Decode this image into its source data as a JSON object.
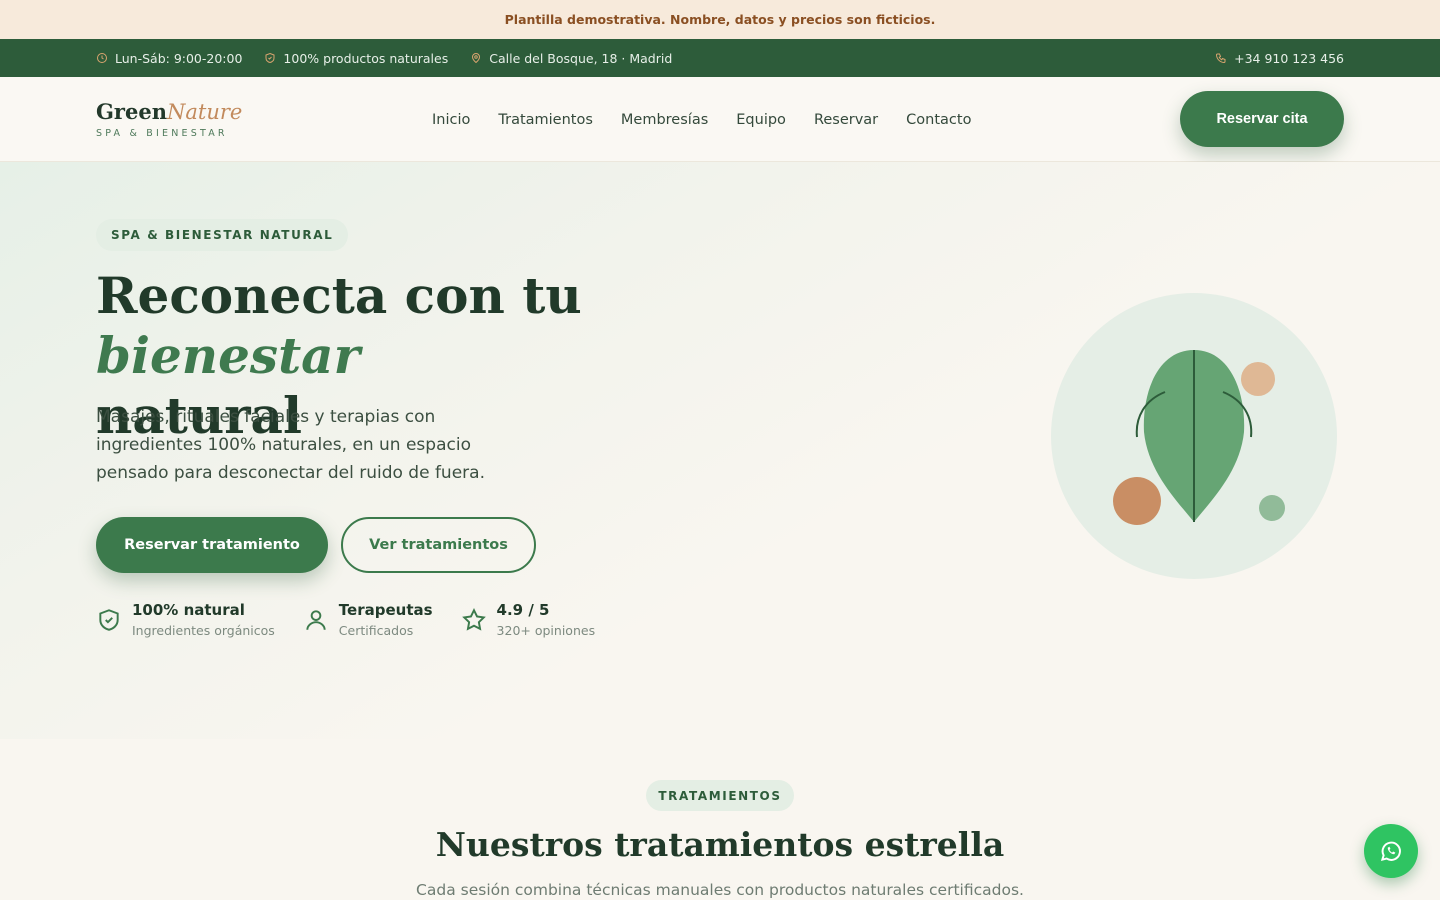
{
  "notice": "Plantilla demostrativa. Nombre, datos y precios son ficticios.",
  "topbar": {
    "hours": "Lun-Sáb: 9:00-20:00",
    "natural": "100% productos naturales",
    "address": "Calle del Bosque, 18 · Madrid",
    "phone": "+34 910 123 456"
  },
  "header": {
    "logo_main": "Green",
    "logo_accent": "Nature",
    "logo_sub": "SPA & BIENESTAR",
    "nav": [
      "Inicio",
      "Tratamientos",
      "Membresías",
      "Equipo",
      "Reservar",
      "Contacto"
    ],
    "cta": "Reservar cita"
  },
  "hero": {
    "eyebrow": "SPA & BIENESTAR NATURAL",
    "title_start": "Reconecta con tu ",
    "title_accent": "bienestar",
    "title_end": "natural",
    "description": "Masajes, rituales faciales y terapias con ingredientes 100% naturales, en un espacio pensado para desconectar del ruido de fuera.",
    "primary_cta": "Reservar tratamiento",
    "secondary_cta": "Ver tratamientos",
    "features": [
      {
        "title": "100% natural",
        "subtitle": "Ingredientes orgánicos",
        "icon": "shield-check-icon"
      },
      {
        "title": "Terapeutas",
        "subtitle": "Certificados",
        "icon": "user-icon"
      },
      {
        "title": "4.9 / 5",
        "subtitle": "320+ opiniones",
        "icon": "star-icon"
      }
    ]
  },
  "treatments": {
    "eyebrow": "TRATAMIENTOS",
    "title": "Nuestros tratamientos estrella",
    "description": "Cada sesión combina técnicas manuales con productos naturales certificados."
  },
  "colors": {
    "primary": "#3c7a4c",
    "dark_green": "#2d5c3a",
    "accent": "#c28a5c",
    "notice_bg": "#f7eadb",
    "whatsapp": "#2fc462"
  }
}
